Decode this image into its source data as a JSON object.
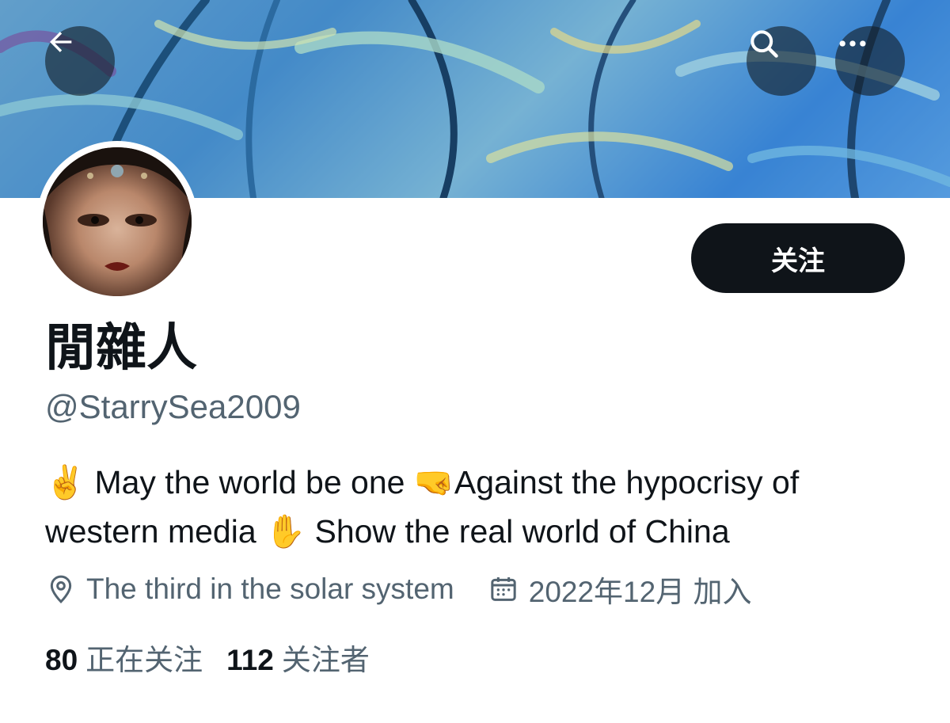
{
  "profile": {
    "display_name": "閒雜人",
    "handle": "@StarrySea2009",
    "bio_line1_parts": [
      "✌️",
      " May the world be one ",
      "🤜",
      "Against the hypocrisy of"
    ],
    "bio_line2_parts": [
      "western media ",
      "✋",
      " Show the real world of China"
    ],
    "location": "The third in the solar system",
    "joined": "2022年12月 加入"
  },
  "actions": {
    "follow_label": "关注"
  },
  "stats": {
    "following_count": "80",
    "following_label": "正在关注",
    "followers_count": "112",
    "followers_label": "关注者"
  },
  "icons": {
    "back": "arrow-left-icon",
    "search": "search-icon",
    "more": "more-horizontal-icon",
    "location": "location-pin-icon",
    "calendar": "calendar-icon"
  },
  "colors": {
    "text_primary": "#0f1419",
    "text_secondary": "#536471",
    "follow_button_bg": "#0f1419",
    "follow_button_text": "#ffffff"
  }
}
